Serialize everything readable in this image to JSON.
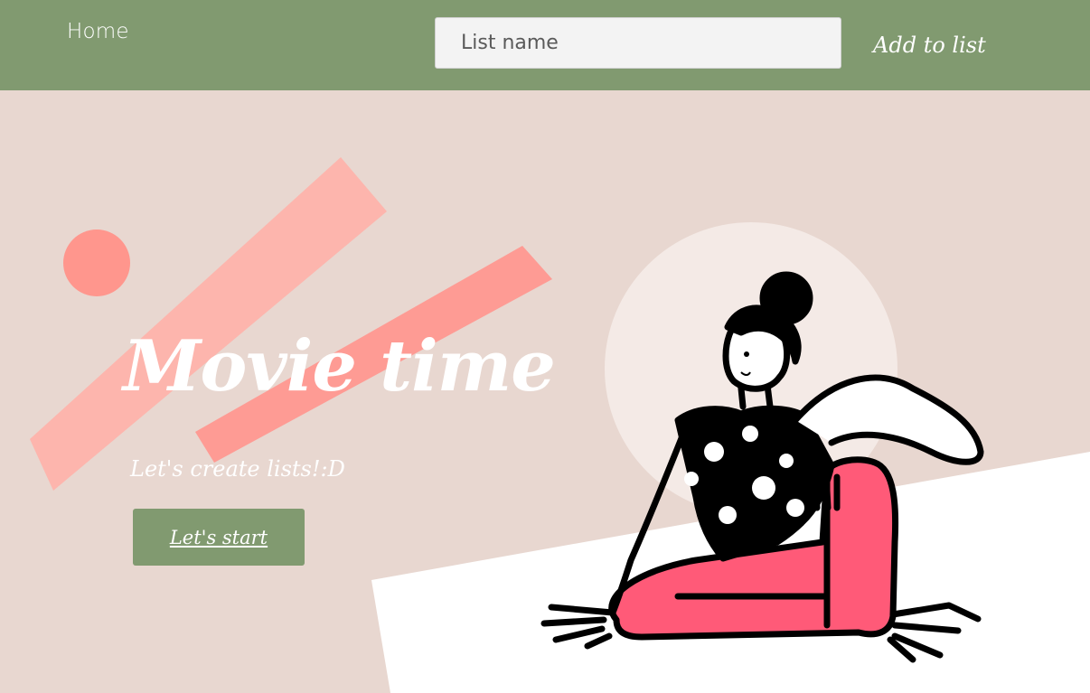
{
  "nav": {
    "home_label": "Home",
    "list_input_placeholder": "List name",
    "list_input_value": "",
    "add_button_label": "Add to list"
  },
  "hero": {
    "title": "Movie time",
    "subtitle": "Let's create lists!:D",
    "start_button_label": "Let's start"
  },
  "colors": {
    "nav_bg": "#819a70",
    "page_bg": "#e8d7d0",
    "accent_pink": "#ff9a91",
    "accent_pink_light": "#ffb3ab",
    "figure_pants": "#ff5a78",
    "button_bg": "#819a70"
  }
}
